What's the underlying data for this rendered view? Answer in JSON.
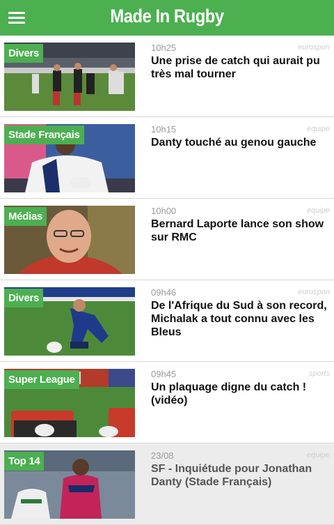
{
  "app": {
    "title": "Made In Rugby",
    "accent": "#4caf50"
  },
  "articles": [
    {
      "tag": "Divers",
      "time": "10h25",
      "source": "eurospon",
      "headline": "Une prise de catch qui aurait pu très mal tourner",
      "image": "rugby-match-photo",
      "read": false
    },
    {
      "tag": "Stade Français",
      "time": "10h15",
      "source": "equipe",
      "headline": "Danty touché au genou gauche",
      "image": "player-stade-francais-photo",
      "read": false
    },
    {
      "tag": "Médias",
      "time": "10h00",
      "source": "equipe",
      "headline": "Bernard Laporte lance son show sur RMC",
      "image": "portrait-photo",
      "read": false
    },
    {
      "tag": "Divers",
      "time": "09h46",
      "source": "eurospon",
      "headline": "De l'Afrique du Sud à son record, Michalak a tout connu avec les Bleus",
      "image": "kicker-photo",
      "read": false
    },
    {
      "tag": "Super League",
      "time": "09h45",
      "source": "sports",
      "headline": "Un plaquage digne du catch ! (vidéo)",
      "image": "stadium-photo",
      "read": false
    },
    {
      "tag": "Top 14",
      "time": "23/08",
      "source": "equipe",
      "headline": "SF - Inquiétude pour Jonathan Danty (Stade Français)",
      "image": "match-photo",
      "read": true
    }
  ]
}
